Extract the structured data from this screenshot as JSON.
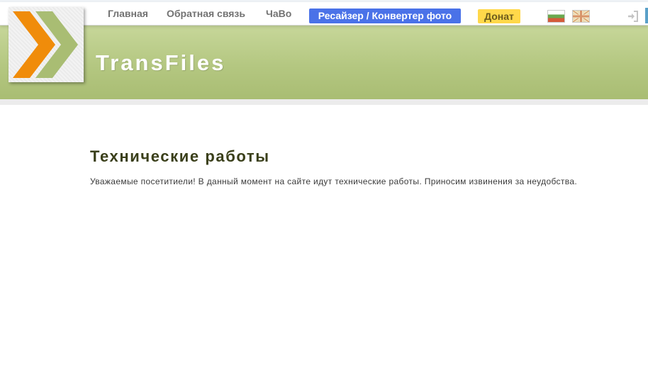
{
  "nav": {
    "home": "Главная",
    "feedback": "Обратная связь",
    "faq": "ЧаВо",
    "resizer": "Ресайзер / Конвертер фото",
    "donate": "Донат"
  },
  "icons": {
    "logo": "chevron-arrows-logo",
    "lang_ru": "russian-flag-icon",
    "lang_en": "uk-flag-icon",
    "login": "login-icon"
  },
  "site": {
    "name": "TransFiles"
  },
  "main": {
    "title": "Технические работы",
    "text": "Уважаемые посетитиели! В данный момент на сайте идут технические работы. Приносим извинения за неудобства."
  },
  "colors": {
    "header_green": "#b4c781",
    "resizer_blue": "#4a72e8",
    "donate_yellow": "#ffd84a",
    "logo_orange": "#f08c0a",
    "logo_green": "#a9bd73",
    "title_dark": "#3a3f1a"
  }
}
